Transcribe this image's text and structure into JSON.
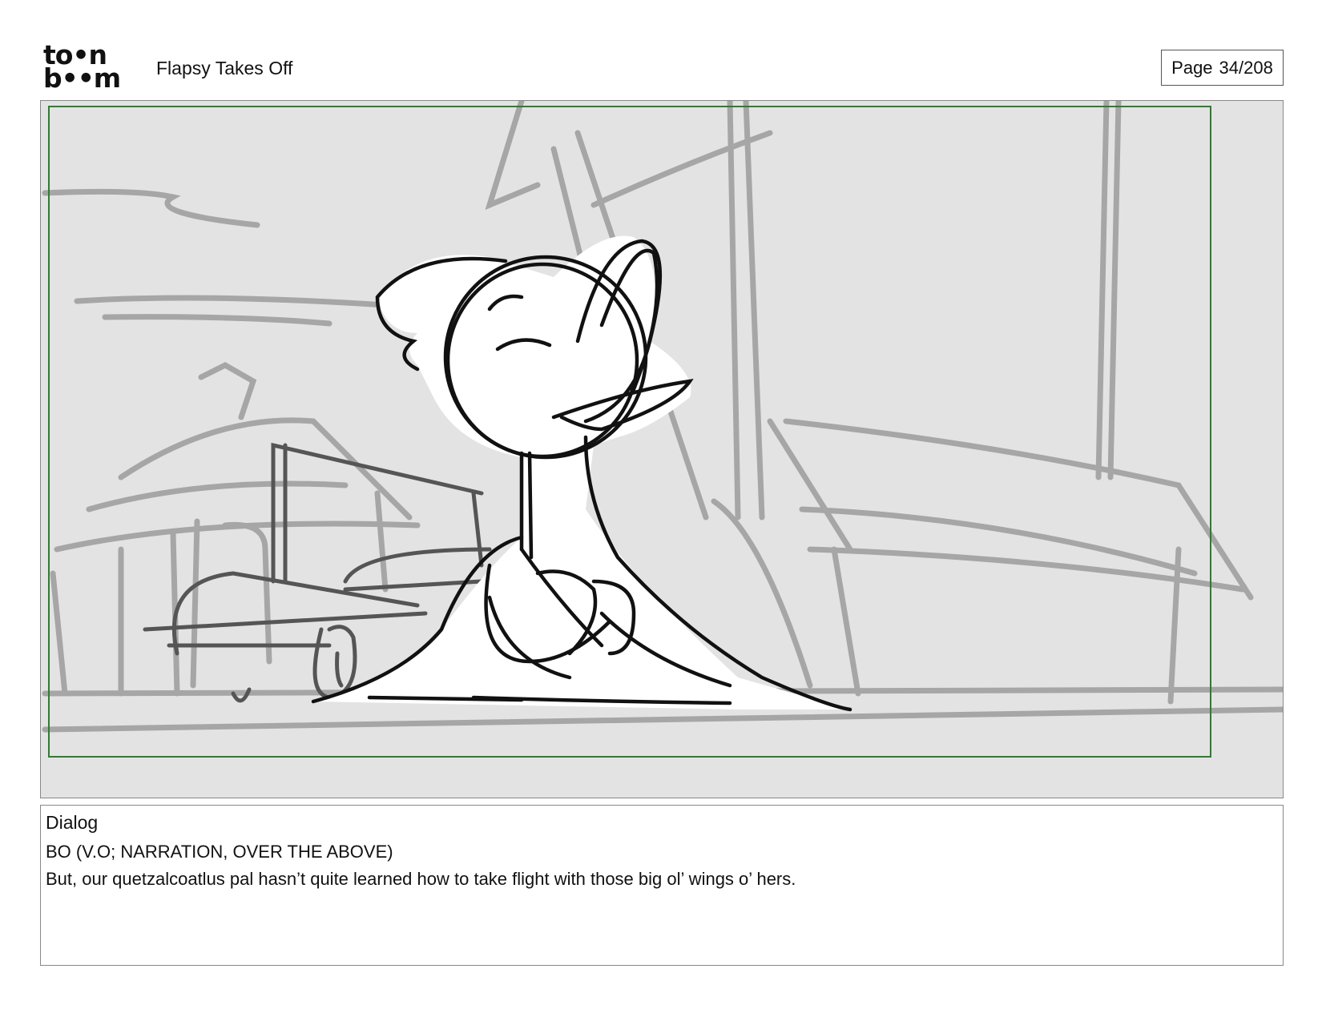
{
  "header": {
    "logo_line1": "to•n",
    "logo_line2": "b••m",
    "project_title": "Flapsy Takes Off",
    "page_label": "Page",
    "page_number": "34/208"
  },
  "panel": {
    "frame_color": "#2e7d2e",
    "background_color": "#e3e3e3",
    "drawing_description_icon": "storyboard-sketch"
  },
  "dialog": {
    "heading": "Dialog",
    "character": "BO (V.O; NARRATION, OVER THE ABOVE)",
    "line": "But, our quetzalcoatlus pal hasn’t quite learned how to take flight with those big ol’ wings o’ hers."
  }
}
